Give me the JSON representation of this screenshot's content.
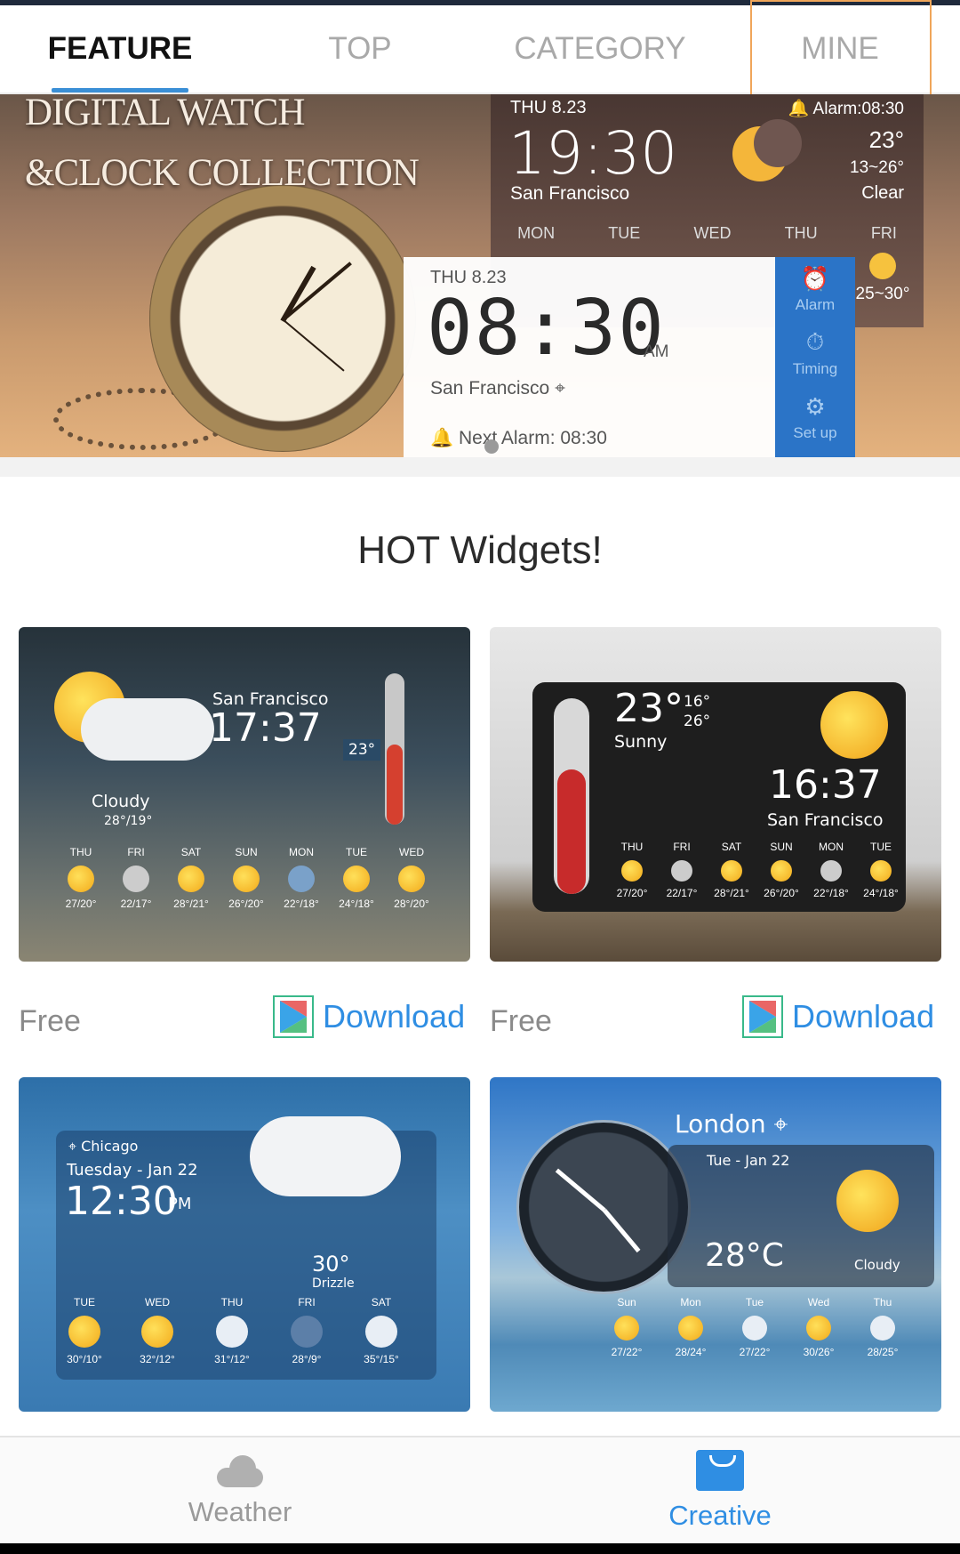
{
  "tabs": [
    {
      "label": "FEATURE"
    },
    {
      "label": "TOP"
    },
    {
      "label": "CATEGORY"
    },
    {
      "label": "MINE"
    }
  ],
  "banner": {
    "title_line1": "DIGITAL WATCH",
    "title_line2": "&CLOCK COLLECTION",
    "card1": {
      "date": "THU 8.23",
      "time": "19:30",
      "city": "San Francisco",
      "alarm": "Alarm:08:30",
      "temp": "23°",
      "range": "13~26°",
      "condition": "Clear",
      "days": [
        "MON",
        "TUE",
        "WED",
        "THU",
        "FRI"
      ],
      "fri_range": "25~30°"
    },
    "card2": {
      "date": "THU 8.23",
      "time": "08:30",
      "ampm": "AM",
      "city": "San Francisco",
      "next_alarm": "Next Alarm: 08:30"
    },
    "side": {
      "alarm": "Alarm",
      "timing": "Timing",
      "setup": "Set up"
    }
  },
  "section_title": "HOT Widgets!",
  "widgets": [
    {
      "price": "Free",
      "download": "Download",
      "city": "San Francisco",
      "time": "17:37",
      "cond": "Cloudy",
      "range": "28°/19°",
      "temp": "23°",
      "days": [
        "THU",
        "FRI",
        "SAT",
        "SUN",
        "MON",
        "TUE",
        "WED"
      ],
      "temps": [
        "27/20°",
        "22/17°",
        "28°/21°",
        "26°/20°",
        "22°/18°",
        "24°/18°",
        "28°/20°"
      ]
    },
    {
      "price": "Free",
      "download": "Download",
      "temp": "23°",
      "hi": "16°",
      "lo": "26°",
      "cond": "Sunny",
      "time": "16:37",
      "city": "San Francisco",
      "days": [
        "THU",
        "FRI",
        "SAT",
        "SUN",
        "MON",
        "TUE"
      ],
      "temps": [
        "27/20°",
        "22/17°",
        "28°/21°",
        "26°/20°",
        "22°/18°",
        "24°/18°"
      ]
    },
    {
      "city": "Chicago",
      "date": "Tuesday - Jan 22",
      "time": "12:30",
      "ampm": "PM",
      "temp": "30°",
      "cond": "Drizzle",
      "days": [
        "TUE",
        "WED",
        "THU",
        "FRI",
        "SAT"
      ],
      "temps": [
        "30°/10°",
        "32°/12°",
        "31°/12°",
        "28°/9°",
        "35°/15°"
      ]
    },
    {
      "city": "London",
      "date": "Tue - Jan 22",
      "temp": "28°C",
      "cond": "Cloudy",
      "days": [
        "Sun",
        "Mon",
        "Tue",
        "Wed",
        "Thu"
      ],
      "temps": [
        "27/22°",
        "28/24°",
        "27/22°",
        "30/26°",
        "28/25°"
      ]
    }
  ],
  "bottom_nav": [
    {
      "label": "Weather"
    },
    {
      "label": "Creative"
    }
  ],
  "colors": {
    "accent": "#2f8ee3",
    "tab_indicator": "#3a8fd6"
  }
}
